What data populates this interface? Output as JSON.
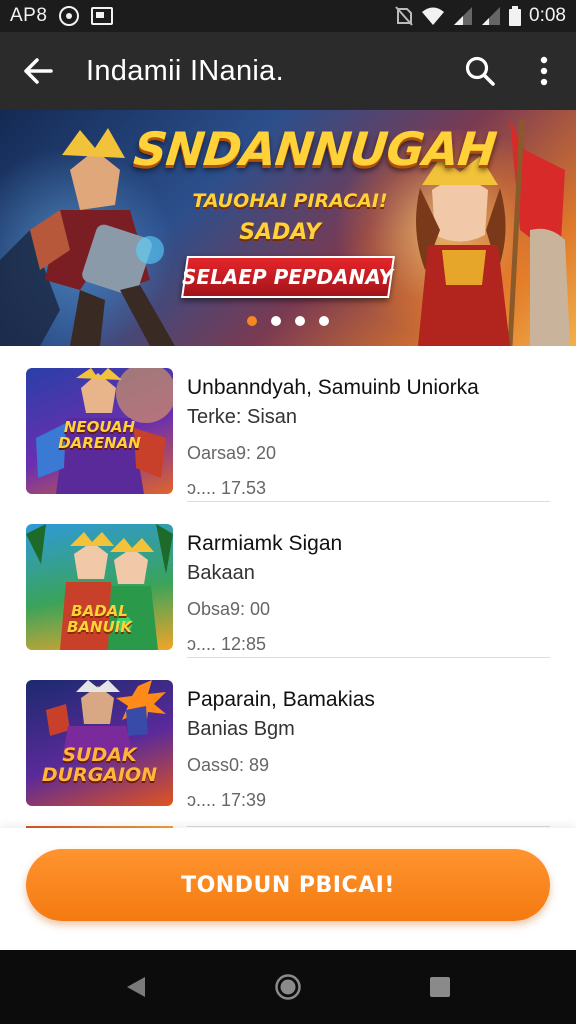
{
  "status_bar": {
    "carrier": "AP8",
    "time": "0:08",
    "icons": [
      "circle-notification-icon",
      "screen-cast-icon",
      "no-sim-icon",
      "wifi-icon",
      "signal-icon",
      "signal-icon",
      "battery-icon"
    ]
  },
  "app_bar": {
    "title": "Indamii INania.",
    "back_icon": "arrow-left-icon",
    "search_icon": "search-icon",
    "more_icon": "more-vertical-icon"
  },
  "banner": {
    "title": "SNDANNUGAH",
    "subtitle_line1": "TAUOHAI PIRACAI!",
    "subtitle_line2": "SADAY",
    "ribbon": "SELAEP PEPDANAY",
    "slides": 4,
    "active_slide": 0,
    "accent_color": "#f7881f"
  },
  "items": [
    {
      "title": "Unbanndyah, Samuinb Uniorka",
      "subtitle": "Terke: Sisan",
      "meta": "Oarsa9: 20",
      "time": "ɔ.... 17.53",
      "thumb_label": "NEOUAH\nDARENAN",
      "thumb_colors": [
        "#2a3fa8",
        "#6a2fb0",
        "#e0642a"
      ]
    },
    {
      "title": "Rarmiamk Sigan",
      "subtitle": "Bakaan",
      "meta": "Obsa9: 00",
      "time": "ɔ.... 12:85",
      "thumb_label": "BADAL\nBANUIK",
      "thumb_colors": [
        "#2f9ad6",
        "#3aa35a",
        "#f1a52a"
      ]
    },
    {
      "title": "Paparain, Bamakias",
      "subtitle": "Banias Bgm",
      "meta": "Oass0: 89",
      "time": "ɔ.... 17:39",
      "thumb_label": "SUDAK\nDURGAION",
      "thumb_colors": [
        "#1b2a6e",
        "#5a2a9a",
        "#e0541e"
      ]
    }
  ],
  "cta": {
    "label": "TONDUN PBICAI!",
    "color": "#f47a10"
  },
  "nav_bar": {
    "back_icon": "nav-back-triangle-icon",
    "home_icon": "nav-home-circle-icon",
    "recents_icon": "nav-recents-square-icon"
  }
}
